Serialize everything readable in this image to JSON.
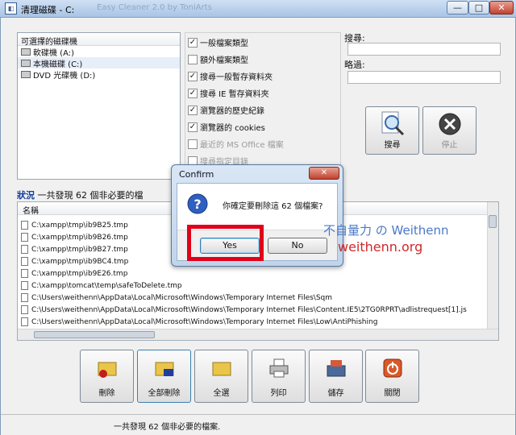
{
  "window": {
    "title": "清理磁碟 - C:",
    "title_faded": "Easy Cleaner 2.0 by ToniArts",
    "min": "—",
    "max": "□",
    "close": "✕"
  },
  "drives": {
    "header": "可選擇的磁碟機",
    "items": [
      {
        "label": "軟碟機 (A:)"
      },
      {
        "label": "本機磁碟 (C:)"
      },
      {
        "label": "DVD 光碟機 (D:)"
      }
    ]
  },
  "options": [
    {
      "label": "一般檔案類型",
      "checked": true,
      "enabled": true
    },
    {
      "label": "額外檔案類型",
      "checked": false,
      "enabled": true
    },
    {
      "label": "搜尋一般暫存資料夾",
      "checked": true,
      "enabled": true
    },
    {
      "label": "搜尋 IE 暫存資料夾",
      "checked": true,
      "enabled": true
    },
    {
      "label": "瀏覽器的歷史紀錄",
      "checked": true,
      "enabled": true
    },
    {
      "label": "瀏覽器的 cookies",
      "checked": true,
      "enabled": true
    },
    {
      "label": "最近的 MS Office 檔案",
      "checked": false,
      "enabled": false
    },
    {
      "label": "搜尋指定目錄",
      "checked": false,
      "enabled": false
    }
  ],
  "search": {
    "label": "搜尋:",
    "value": ""
  },
  "skip": {
    "label": "略過:",
    "value": ""
  },
  "buttons": {
    "search": "搜尋",
    "stop": "停止"
  },
  "status": {
    "key": "狀況",
    "text": "一共發現 62 個非必要的檔"
  },
  "files": {
    "column": "名稱",
    "rows": [
      "C:\\xampp\\tmp\\ib9B25.tmp",
      "C:\\xampp\\tmp\\ib9B26.tmp",
      "C:\\xampp\\tmp\\ib9B27.tmp",
      "C:\\xampp\\tmp\\ib9BC4.tmp",
      "C:\\xampp\\tmp\\ib9E26.tmp",
      "C:\\xampp\\tomcat\\temp\\safeToDelete.tmp",
      "C:\\Users\\weithenn\\AppData\\Local\\Microsoft\\Windows\\Temporary Internet Files\\Sqm",
      "C:\\Users\\weithenn\\AppData\\Local\\Microsoft\\Windows\\Temporary Internet Files\\Content.IE5\\2TG0RPRT\\adlistrequest[1].js",
      "C:\\Users\\weithenn\\AppData\\Local\\Microsoft\\Windows\\Temporary Internet Files\\Low\\AntiPhishing"
    ]
  },
  "actions": {
    "delete": "刪除",
    "delete_all": "全部刪除",
    "select_all": "全選",
    "print": "列印",
    "save": "儲存",
    "close": "關閉"
  },
  "statusbar": {
    "text": "一共發現 62 個非必要的檔案."
  },
  "dialog": {
    "title": "Confirm",
    "message": "你確定要刪除這 62 個檔案?",
    "yes": "Yes",
    "no": "No",
    "close": "✕"
  },
  "watermark": {
    "line1": "不自量力 の Weithenn",
    "line2": "weithenn.org"
  },
  "colors": {
    "status_key": "#103a9a",
    "highlight": "#e0001a",
    "watermark_blue": "#4a78c8",
    "watermark_red": "#d02828"
  }
}
